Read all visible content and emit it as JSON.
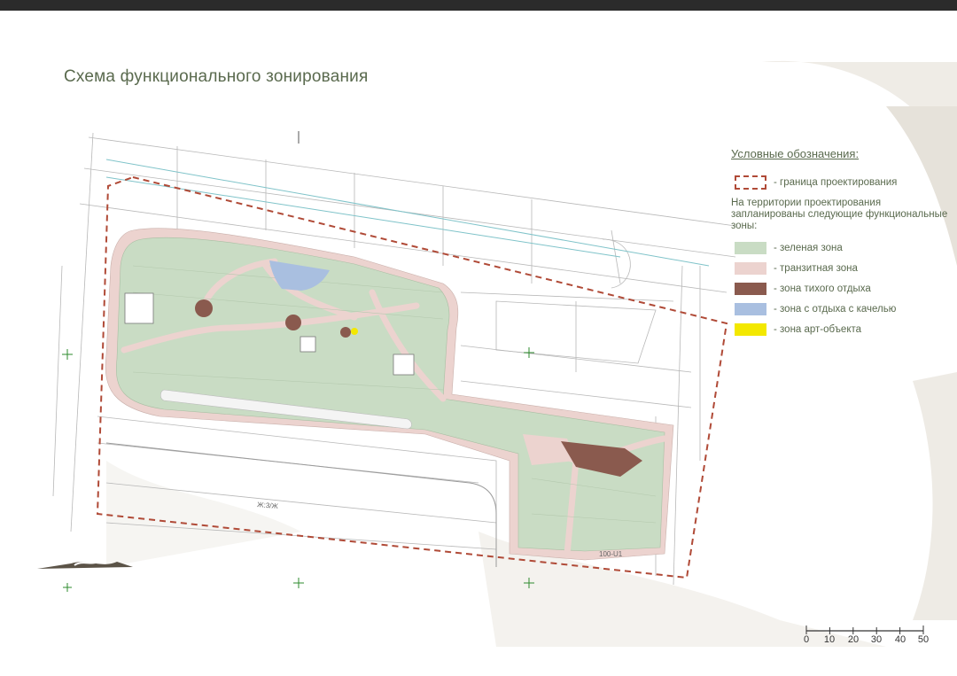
{
  "title": "Схема функционального зонирования",
  "legend": {
    "heading": "Условные обозначения:",
    "boundary_label": "- граница проектирования",
    "note": "На территории проектирования запланированы следующие функциональные зоны:",
    "zones": [
      {
        "label": "- зеленая зона",
        "color": "#c9dcc4"
      },
      {
        "label": "- транзитная зона",
        "color": "#ecd3cf"
      },
      {
        "label": "- зона тихого отдыха",
        "color": "#8a5a4e"
      },
      {
        "label": "- зона с отдыха с качелью",
        "color": "#a9bfe0"
      },
      {
        "label": "- зона арт-объекта",
        "color": "#f3e800"
      }
    ],
    "boundary_color": "#b04a37"
  },
  "scale_bar": {
    "ticks": [
      "0",
      "10",
      "20",
      "30",
      "40",
      "50"
    ]
  },
  "plan_labels": {
    "road_label": "Ж:3/Ж",
    "lower_label": "100-U1"
  },
  "icons": [
    "north-arrow-icon",
    "grid-cross-icon"
  ]
}
